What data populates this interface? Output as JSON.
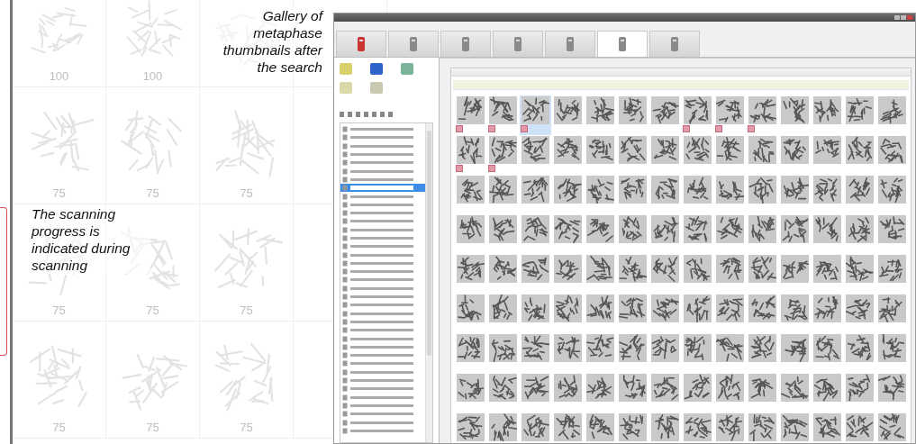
{
  "background_gallery": {
    "rows": [
      {
        "labels": [
          "100",
          "100"
        ]
      },
      {
        "labels": [
          "75",
          "75",
          "75"
        ]
      },
      {
        "labels": [
          "75",
          "75",
          "75"
        ]
      },
      {
        "labels": [
          "75",
          "75",
          "75"
        ]
      }
    ]
  },
  "captions": [
    {
      "kind": "top",
      "text": "Gallery of metaphase thumbnails after the search"
    },
    {
      "kind": "side",
      "text": "The scanning progress is indicated during scanning"
    }
  ],
  "app_window": {
    "tabs": [
      {
        "selected": false
      },
      {
        "selected": false
      },
      {
        "selected": false
      },
      {
        "selected": false
      },
      {
        "selected": false
      },
      {
        "selected": true
      },
      {
        "selected": false
      }
    ],
    "tree_items": [
      {
        "selected": false
      },
      {
        "selected": false
      },
      {
        "selected": false
      },
      {
        "selected": false
      },
      {
        "selected": false
      },
      {
        "selected": false
      },
      {
        "selected": false
      },
      {
        "selected": true
      },
      {
        "selected": false
      },
      {
        "selected": false
      },
      {
        "selected": false
      },
      {
        "selected": false
      },
      {
        "selected": false
      },
      {
        "selected": false
      },
      {
        "selected": false
      },
      {
        "selected": false
      },
      {
        "selected": false
      },
      {
        "selected": false
      },
      {
        "selected": false
      },
      {
        "selected": false
      },
      {
        "selected": false
      },
      {
        "selected": false
      },
      {
        "selected": false
      },
      {
        "selected": false
      },
      {
        "selected": false
      },
      {
        "selected": false
      },
      {
        "selected": false
      },
      {
        "selected": false
      },
      {
        "selected": false
      },
      {
        "selected": false
      },
      {
        "selected": false
      },
      {
        "selected": false
      },
      {
        "selected": false
      },
      {
        "selected": false
      },
      {
        "selected": false
      },
      {
        "selected": false
      },
      {
        "selected": false
      }
    ],
    "thumbnail_rows": [
      {
        "tiles": [
          {
            "marked": true,
            "selected": false
          },
          {
            "marked": true,
            "selected": false
          },
          {
            "marked": true,
            "selected": true
          },
          {
            "marked": false,
            "selected": false
          },
          {
            "marked": false,
            "selected": false
          },
          {
            "marked": false,
            "selected": false
          },
          {
            "marked": false,
            "selected": false
          },
          {
            "marked": true,
            "selected": false
          },
          {
            "marked": true,
            "selected": false
          },
          {
            "marked": true,
            "selected": false
          },
          {
            "marked": false,
            "selected": false
          },
          {
            "marked": false,
            "selected": false
          },
          {
            "marked": false,
            "selected": false
          },
          {
            "marked": false,
            "selected": false
          }
        ]
      },
      {
        "tiles": [
          {
            "marked": true,
            "selected": false
          },
          {
            "marked": true,
            "selected": false
          },
          {
            "marked": false,
            "selected": false
          },
          {
            "marked": false,
            "selected": false
          },
          {
            "marked": false,
            "selected": false
          },
          {
            "marked": false,
            "selected": false
          },
          {
            "marked": false,
            "selected": false
          },
          {
            "marked": false,
            "selected": false
          },
          {
            "marked": false,
            "selected": false
          },
          {
            "marked": false,
            "selected": false
          },
          {
            "marked": false,
            "selected": false
          },
          {
            "marked": false,
            "selected": false
          },
          {
            "marked": false,
            "selected": false
          },
          {
            "marked": false,
            "selected": false
          }
        ]
      },
      {
        "tiles": [
          {
            "marked": false,
            "selected": false
          },
          {
            "marked": false,
            "selected": false
          },
          {
            "marked": false,
            "selected": false
          },
          {
            "marked": false,
            "selected": false
          },
          {
            "marked": false,
            "selected": false
          },
          {
            "marked": false,
            "selected": false
          },
          {
            "marked": false,
            "selected": false
          },
          {
            "marked": false,
            "selected": false
          },
          {
            "marked": false,
            "selected": false
          },
          {
            "marked": false,
            "selected": false
          },
          {
            "marked": false,
            "selected": false
          },
          {
            "marked": false,
            "selected": false
          },
          {
            "marked": false,
            "selected": false
          },
          {
            "marked": false,
            "selected": false
          }
        ]
      },
      {
        "tiles": [
          {
            "marked": false,
            "selected": false
          },
          {
            "marked": false,
            "selected": false
          },
          {
            "marked": false,
            "selected": false
          },
          {
            "marked": false,
            "selected": false
          },
          {
            "marked": false,
            "selected": false
          },
          {
            "marked": false,
            "selected": false
          },
          {
            "marked": false,
            "selected": false
          },
          {
            "marked": false,
            "selected": false
          },
          {
            "marked": false,
            "selected": false
          },
          {
            "marked": false,
            "selected": false
          },
          {
            "marked": false,
            "selected": false
          },
          {
            "marked": false,
            "selected": false
          },
          {
            "marked": false,
            "selected": false
          },
          {
            "marked": false,
            "selected": false
          }
        ]
      },
      {
        "tiles": [
          {
            "marked": false,
            "selected": false
          },
          {
            "marked": false,
            "selected": false
          },
          {
            "marked": false,
            "selected": false
          },
          {
            "marked": false,
            "selected": false
          },
          {
            "marked": false,
            "selected": false
          },
          {
            "marked": false,
            "selected": false
          },
          {
            "marked": false,
            "selected": false
          },
          {
            "marked": false,
            "selected": false
          },
          {
            "marked": false,
            "selected": false
          },
          {
            "marked": false,
            "selected": false
          },
          {
            "marked": false,
            "selected": false
          },
          {
            "marked": false,
            "selected": false
          },
          {
            "marked": false,
            "selected": false
          },
          {
            "marked": false,
            "selected": false
          }
        ]
      },
      {
        "tiles": [
          {
            "marked": false,
            "selected": false
          },
          {
            "marked": false,
            "selected": false
          },
          {
            "marked": false,
            "selected": false
          },
          {
            "marked": false,
            "selected": false
          },
          {
            "marked": false,
            "selected": false
          },
          {
            "marked": false,
            "selected": false
          },
          {
            "marked": false,
            "selected": false
          },
          {
            "marked": false,
            "selected": false
          },
          {
            "marked": false,
            "selected": false
          },
          {
            "marked": false,
            "selected": false
          },
          {
            "marked": false,
            "selected": false
          },
          {
            "marked": false,
            "selected": false
          },
          {
            "marked": false,
            "selected": false
          },
          {
            "marked": false,
            "selected": false
          }
        ]
      },
      {
        "tiles": [
          {
            "marked": false,
            "selected": false
          },
          {
            "marked": false,
            "selected": false
          },
          {
            "marked": false,
            "selected": false
          },
          {
            "marked": false,
            "selected": false
          },
          {
            "marked": false,
            "selected": false
          },
          {
            "marked": false,
            "selected": false
          },
          {
            "marked": false,
            "selected": false
          },
          {
            "marked": false,
            "selected": false
          },
          {
            "marked": false,
            "selected": false
          },
          {
            "marked": false,
            "selected": false
          },
          {
            "marked": false,
            "selected": false
          },
          {
            "marked": false,
            "selected": false
          },
          {
            "marked": false,
            "selected": false
          },
          {
            "marked": false,
            "selected": false
          }
        ]
      },
      {
        "tiles": [
          {
            "marked": false,
            "selected": false
          },
          {
            "marked": false,
            "selected": false
          },
          {
            "marked": false,
            "selected": false
          },
          {
            "marked": false,
            "selected": false
          },
          {
            "marked": false,
            "selected": false
          },
          {
            "marked": false,
            "selected": false
          },
          {
            "marked": false,
            "selected": false
          },
          {
            "marked": false,
            "selected": false
          },
          {
            "marked": false,
            "selected": false
          },
          {
            "marked": false,
            "selected": false
          },
          {
            "marked": false,
            "selected": false
          },
          {
            "marked": false,
            "selected": false
          },
          {
            "marked": false,
            "selected": false
          },
          {
            "marked": false,
            "selected": false
          }
        ]
      },
      {
        "tiles": [
          {
            "marked": false,
            "selected": false
          },
          {
            "marked": false,
            "selected": false
          },
          {
            "marked": false,
            "selected": false
          },
          {
            "marked": false,
            "selected": false
          },
          {
            "marked": false,
            "selected": false
          },
          {
            "marked": false,
            "selected": false
          },
          {
            "marked": false,
            "selected": false
          },
          {
            "marked": false,
            "selected": false
          },
          {
            "marked": false,
            "selected": false
          },
          {
            "marked": false,
            "selected": false
          },
          {
            "marked": false,
            "selected": false
          },
          {
            "marked": false,
            "selected": false
          },
          {
            "marked": false,
            "selected": false
          },
          {
            "marked": false,
            "selected": false
          }
        ]
      }
    ]
  }
}
